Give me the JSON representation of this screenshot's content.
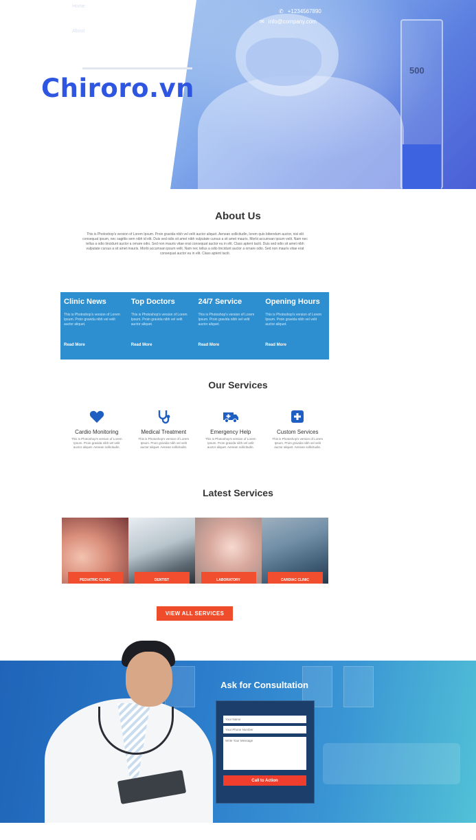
{
  "hero": {
    "contact_phone": "+1234567890",
    "contact_email": "info@company.com",
    "nav_item_1": "Home",
    "nav_item_2": "About",
    "tube_label": "500",
    "brand_overlay": "Chiroro.vn"
  },
  "about": {
    "title": "About Us",
    "text": "This is Photoshop's version of Lorem Ipsum. Proin gravida nibh vel velit auctor aliquet. Aenean sollicitudin, lorem quis bibendum auctor, nisi elit consequat ipsum, nec sagittis sem nibh id elit. Duis sed odio sit amet nibh vulputate cursus a sit amet mauris. Morbi accumsan ipsum velit. Nam nec tellus a odio tincidunt auctor a ornare odio. Sed non mauris vitae erat consequat auctor eu in elit. Class aptent taciti. Duis sed odio sit amet nibh vulputate cursus a sit amet mauris. Morbi accumsan ipsum velit. Nam nec tellus a odio tincidunt auctor a ornare odio. Sed non mauris vitae erat consequat auctor eu in elit. Class aptent taciti."
  },
  "info_bar": {
    "items": [
      {
        "title": "Clinic News",
        "text": "This is Photoshop's version of Lorem Ipsum. Proin gravida nibh vel velit auctor aliquet.",
        "more": "Read More"
      },
      {
        "title": "Top Doctors",
        "text": "This is Photoshop's version of Lorem Ipsum. Proin gravida nibh vel velit auctor aliquet.",
        "more": "Read More"
      },
      {
        "title": "24/7 Service",
        "text": "This is Photoshop's version of Lorem Ipsum. Proin gravida nibh vel velit auctor aliquet.",
        "more": "Read More"
      },
      {
        "title": "Opening Hours",
        "text": "This is Photoshop's version of Lorem Ipsum. Proin gravida nibh vel velit auctor aliquet.",
        "more": "Read More"
      }
    ]
  },
  "services": {
    "title": "Our Services",
    "items": [
      {
        "name": "Cardio Monitoring",
        "icon": "heart-icon",
        "desc": "This is Photoshop's version of Lorem Ipsum. Proin gravida nibh vel velit auctor aliquet. Aenean sollicitudin."
      },
      {
        "name": "Medical Treatment",
        "icon": "stethoscope-icon",
        "desc": "This is Photoshop's version of Lorem Ipsum. Proin gravida nibh vel velit auctor aliquet. Aenean sollicitudin."
      },
      {
        "name": "Emergency Help",
        "icon": "ambulance-icon",
        "desc": "This is Photoshop's version of Lorem Ipsum. Proin gravida nibh vel velit auctor aliquet. Aenean sollicitudin."
      },
      {
        "name": "Custom Services",
        "icon": "medical-cross-icon",
        "desc": "This is Photoshop's version of Lorem Ipsum. Proin gravida nibh vel velit auctor aliquet. Aenean sollicitudin."
      }
    ]
  },
  "latest": {
    "title": "Latest Services",
    "items": [
      {
        "label": "PEDIATRIC CLINIC"
      },
      {
        "label": "DENTIST"
      },
      {
        "label": "LABORATORY"
      },
      {
        "label": "CARDIAC CLINIC"
      }
    ],
    "view_all": "VIEW ALL SERVICES"
  },
  "consultation": {
    "title": "Ask for Consultation",
    "name_placeholder": "Your Name",
    "phone_placeholder": "Your Phone Number",
    "message_placeholder": "Write Your Message",
    "submit": "Call to Action"
  },
  "colors": {
    "brand_overlay": "#2f56e0",
    "info_bar": "#2d8fd0",
    "icon_blue": "#1f5fc2",
    "button_red": "#ef4c2c",
    "consult_start": "#1f64b8",
    "consult_end": "#52c1d6"
  }
}
